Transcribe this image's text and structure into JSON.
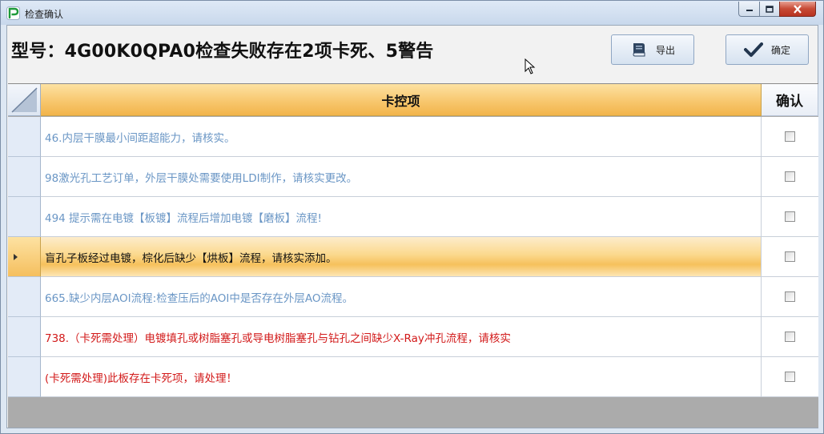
{
  "window": {
    "title": "检查确认",
    "colors": {
      "close_button": "#c74a35",
      "accent": "#f7c56a"
    }
  },
  "header": {
    "title": "型号：4G00K0QPA0检查失败存在2项卡死、5警告",
    "export_label": "导出",
    "ok_label": "确定"
  },
  "grid": {
    "columns": {
      "item": "卡控项",
      "confirm": "确认"
    },
    "rows": [
      {
        "text": "46.内层干膜最小间距超能力，请核实。",
        "color": "blue",
        "checked": false,
        "selected": false
      },
      {
        "text": "98激光孔工艺订单，外层干膜处需要使用LDI制作，请核实更改。",
        "color": "blue",
        "checked": false,
        "selected": false
      },
      {
        "text": "494 提示需在电镀【板镀】流程后增加电镀【磨板】流程!",
        "color": "blue",
        "checked": false,
        "selected": false
      },
      {
        "text": "盲孔子板经过电镀，棕化后缺少【烘板】流程，请核实添加。",
        "color": "dark",
        "checked": false,
        "selected": true
      },
      {
        "text": "665.缺少内层AOI流程:检查压后的AOI中是否存在外层AO流程。",
        "color": "blue",
        "checked": false,
        "selected": false
      },
      {
        "text": "738.（卡死需处理）电镀填孔或树脂塞孔或导电树脂塞孔与钻孔之间缺少X-Ray冲孔流程，请核实",
        "color": "red",
        "checked": false,
        "selected": false
      },
      {
        "text": "(卡死需处理)此板存在卡死项，请处理！",
        "color": "red",
        "checked": false,
        "selected": false
      }
    ]
  }
}
